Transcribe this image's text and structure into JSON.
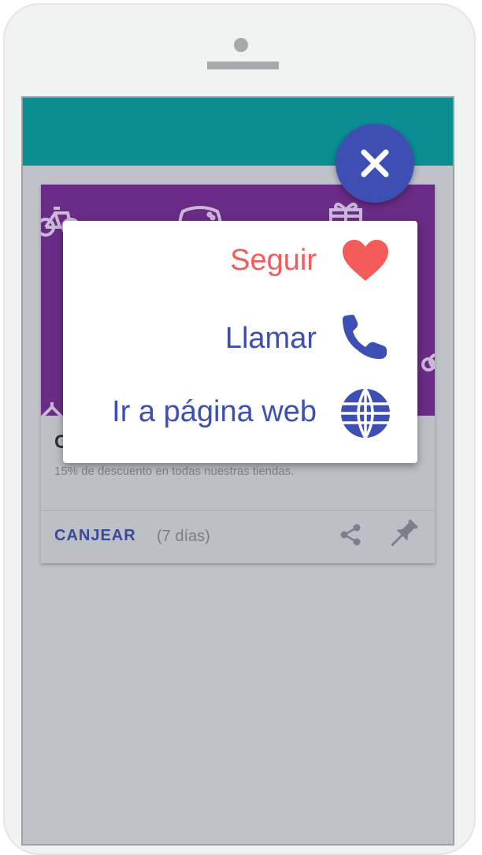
{
  "card": {
    "title": "C",
    "description": "15% de descuento en todas nuestras tiendas.",
    "redeem_label": "CANJEAR",
    "days_left": "(7 días)"
  },
  "fab": {
    "icon": "close-icon"
  },
  "menu": {
    "items": [
      {
        "label": "Seguir",
        "icon": "heart-icon",
        "color": "#f45b5b"
      },
      {
        "label": "Llamar",
        "icon": "phone-icon",
        "color": "#3d4fb3"
      },
      {
        "label": "Ir a página web",
        "icon": "globe-icon",
        "color": "#3d4fb3"
      }
    ]
  },
  "colors": {
    "app_bar": "#0c8d94",
    "banner": "#6a2b86",
    "accent": "#3d4fb3",
    "follow": "#f45b5b"
  }
}
